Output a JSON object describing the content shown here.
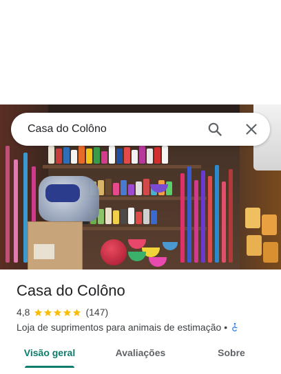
{
  "search": {
    "query": "Casa do Colôno"
  },
  "place": {
    "name": "Casa do Colôno",
    "rating": "4,8",
    "stars": 5,
    "review_count": "(147)",
    "category": "Loja de suprimentos para animais de estimação",
    "separator": "•"
  },
  "tabs": [
    {
      "label": "Visão geral",
      "active": true
    },
    {
      "label": "Avaliações",
      "active": false
    },
    {
      "label": "Sobre",
      "active": false
    }
  ],
  "colors": {
    "accent": "#0b7c6b",
    "star": "#fbbc04",
    "accessibility": "#1a73e8"
  },
  "icons": {
    "search": "search-icon",
    "close": "close-icon",
    "star": "star-icon",
    "accessibility": "wheelchair-accessible-icon"
  }
}
